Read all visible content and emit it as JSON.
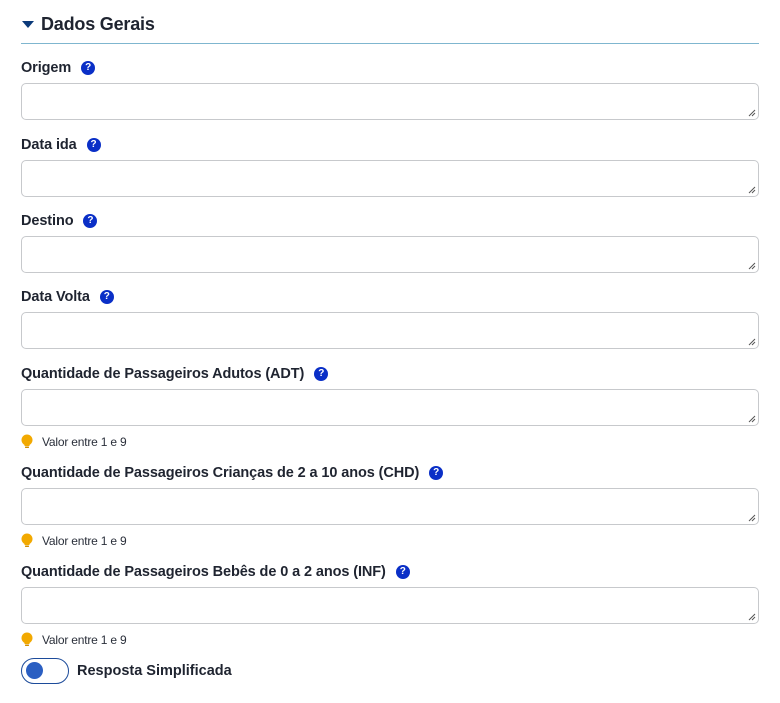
{
  "section": {
    "title": "Dados Gerais"
  },
  "fields": [
    {
      "label": "Origem",
      "value": "",
      "hint": ""
    },
    {
      "label": "Data ida",
      "value": "",
      "hint": ""
    },
    {
      "label": "Destino",
      "value": "",
      "hint": ""
    },
    {
      "label": "Data Volta",
      "value": "",
      "hint": ""
    },
    {
      "label": "Quantidade de Passageiros Adutos (ADT)",
      "value": "",
      "hint": "Valor entre 1 e 9"
    },
    {
      "label": "Quantidade de Passageiros Crianças de 2 a 10 anos (CHD)",
      "value": "",
      "hint": "Valor entre 1 e 9"
    },
    {
      "label": "Quantidade de Passageiros Bebês de 0 a 2 anos (INF)",
      "value": "",
      "hint": "Valor entre 1 e 9"
    }
  ],
  "help_glyph": "?",
  "toggle": {
    "label": "Resposta Simplificada",
    "state": "off"
  },
  "colors": {
    "help_icon": "#0a2fc7",
    "bulb": "#f2a900",
    "divider": "#7fb6cf",
    "toggle": "#2b5fc2"
  }
}
